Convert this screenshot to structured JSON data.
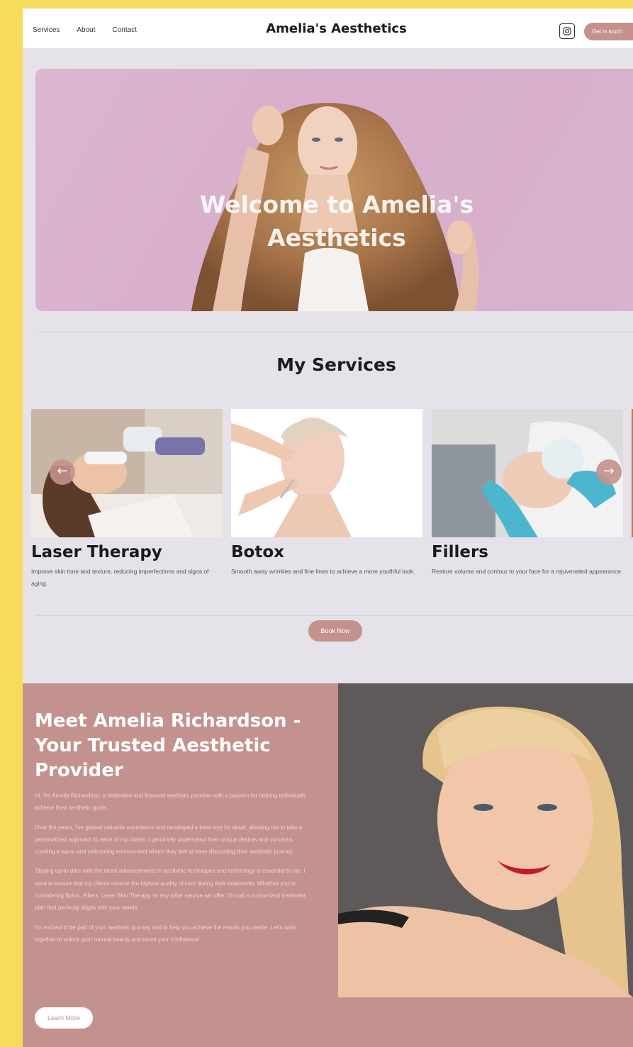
{
  "header": {
    "nav": [
      "Services",
      "About",
      "Contact"
    ],
    "brand": "Amelia's Aesthetics",
    "cta_label": "Get in touch",
    "instagram_icon": "instagram-icon"
  },
  "hero": {
    "title": "Welcome to Amelia's Aesthetics"
  },
  "services": {
    "title": "My Services",
    "items": [
      {
        "title": "Laser Therapy",
        "description": "Improve skin tone and texture, reducing imperfections and signs of aging."
      },
      {
        "title": "Botox",
        "description": "Smooth away wrinkles and fine lines to achieve a more youthful look."
      },
      {
        "title": "Fillers",
        "description": "Restore volume and contour to your face for a rejuvenated appearance."
      }
    ],
    "prev_icon": "arrow-left-icon",
    "next_icon": "arrow-right-icon",
    "book_label": "Book Now"
  },
  "about": {
    "title": "Meet Amelia Richardson - Your Trusted Aesthetic Provider",
    "paragraphs": [
      "Hi, I'm Amelia Richardson, a dedicated and licensed aesthetic provider with a passion for helping individuals achieve their aesthetic goals.",
      "Over the years, I've gained valuable experience and developed a keen eye for detail, allowing me to take a personalized approach to each of my clients. I genuinely understand their unique desires and concerns, creating a warm and welcoming environment where they feel at ease discussing their aesthetic journey.",
      "Staying up-to-date with the latest advancements in aesthetic techniques and technology is essential to me. I want to ensure that my clients receive the highest quality of care during their treatments. Whether you're considering Botox, Fillers, Laser Skin Therapy, or any other service we offer, I'll craft a customized treatment plan that perfectly aligns with your needs.",
      "I'm excited to be part of your aesthetic journey and to help you achieve the results you desire. Let's work together to unlock your natural beauty and boost your confidence!"
    ],
    "learn_label": "Learn More"
  },
  "colors": {
    "accent": "#c4918c",
    "frame": "#f6dc5a",
    "page_bg": "#e5e3e9"
  }
}
